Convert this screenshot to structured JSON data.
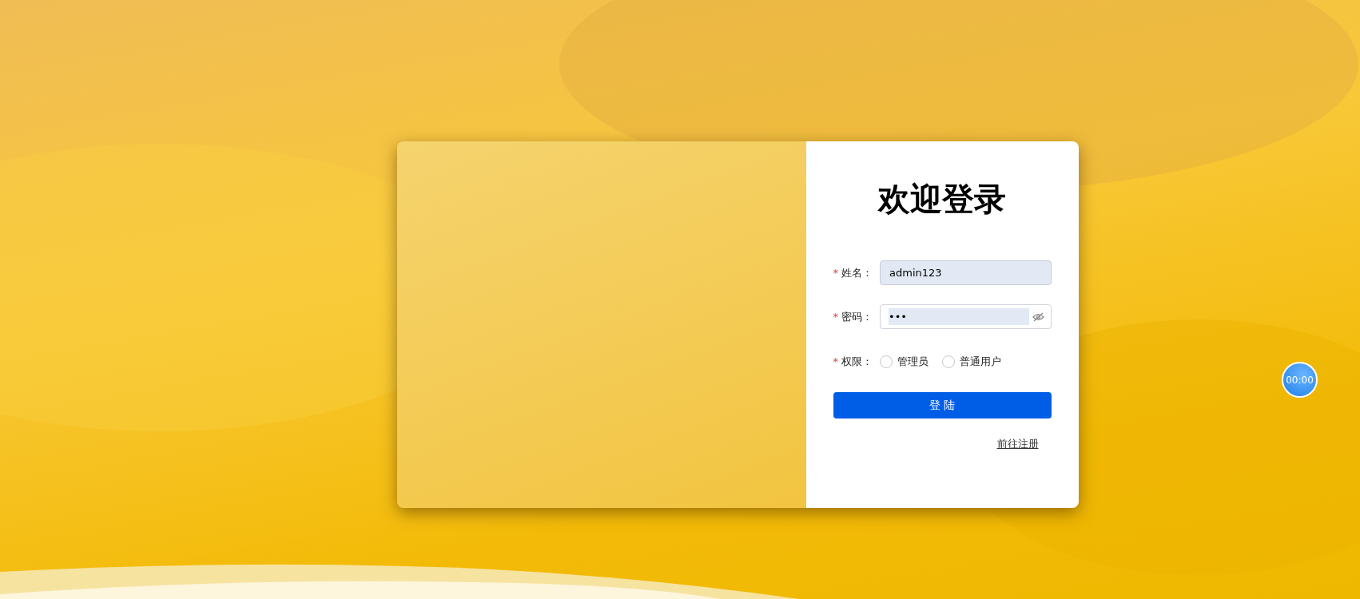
{
  "login": {
    "title": "欢迎登录",
    "fields": [
      {
        "kind": "text",
        "mark": "*",
        "label": "姓名：",
        "value": "admin123"
      },
      {
        "kind": "password",
        "mark": "*",
        "label": "密码：",
        "value": "•••"
      }
    ],
    "role": {
      "mark": "*",
      "label": "权限：",
      "options": [
        {
          "label": "管理员",
          "selected": false
        },
        {
          "label": "普通用户",
          "selected": false
        }
      ]
    },
    "submit": "登 陆",
    "register_link": "前往注册"
  },
  "timer": "00:00"
}
